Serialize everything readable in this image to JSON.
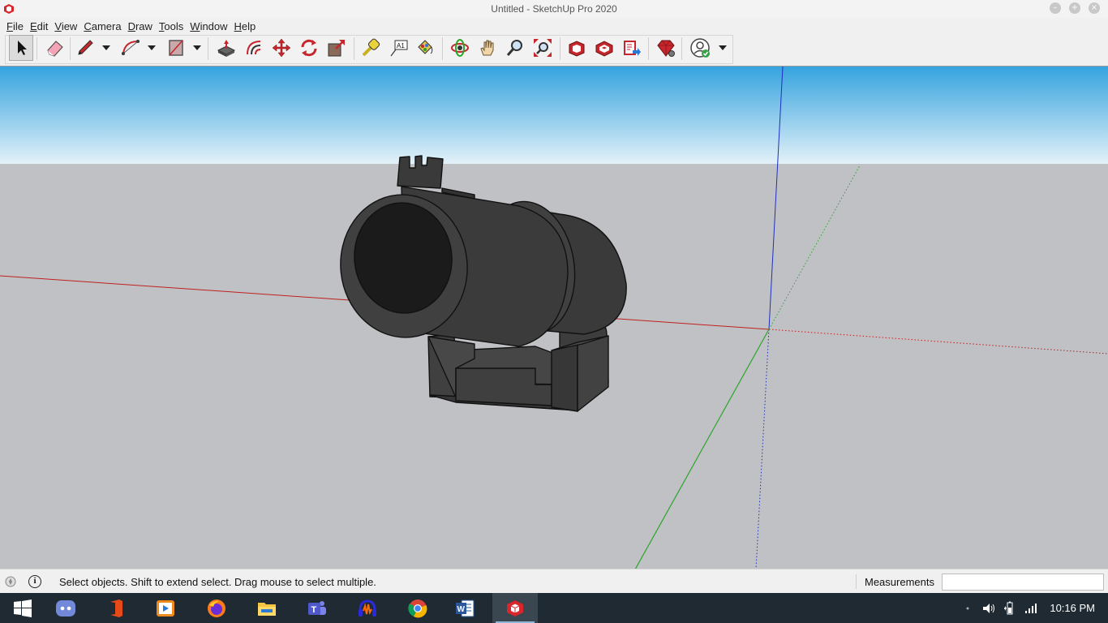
{
  "window": {
    "title": "Untitled - SketchUp Pro 2020",
    "minimize_glyph": "–",
    "maximize_glyph": "+",
    "close_glyph": "×"
  },
  "menu": [
    {
      "label_ul": "F",
      "label_rest": "ile"
    },
    {
      "label_ul": "E",
      "label_rest": "dit"
    },
    {
      "label_ul": "V",
      "label_rest": "iew"
    },
    {
      "label_ul": "C",
      "label_rest": "amera"
    },
    {
      "label_ul": "D",
      "label_rest": "raw"
    },
    {
      "label_ul": "T",
      "label_rest": "ools"
    },
    {
      "label_ul": "W",
      "label_rest": "indow"
    },
    {
      "label_ul": "H",
      "label_rest": "elp"
    }
  ],
  "toolbar": {
    "tools": [
      "select-icon",
      "eraser-icon",
      "pencil-icon",
      "arc-icon",
      "rectangle-icon",
      "push-pull-icon",
      "offset-icon",
      "move-icon",
      "rotate-icon",
      "scale-icon",
      "tape-measure-icon",
      "text-icon",
      "paint-bucket-icon",
      "orbit-icon",
      "pan-icon",
      "zoom-icon",
      "zoom-extents-icon",
      "3d-warehouse-icon",
      "extension-warehouse-icon",
      "send-to-layout-icon",
      "extension-manager-icon",
      "account-icon"
    ]
  },
  "colors": {
    "sky_top": "#35a3df",
    "sky_bottom": "#e3f1f8",
    "ground": "#c0c1c5",
    "red_axis": "#c0201f",
    "green_axis": "#2aa52a",
    "blue_axis": "#1f2fbf",
    "model_fill": "#3d3d3d"
  },
  "status": {
    "message": "Select objects. Shift to extend select. Drag mouse to select multiple.",
    "info_glyph": "i",
    "measurements_label": "Measurements",
    "measurements_value": ""
  },
  "taskbar": {
    "apps": [
      "windows-start-icon",
      "discord-icon",
      "office-icon",
      "media-player-icon",
      "firefox-icon",
      "file-explorer-icon",
      "teams-icon",
      "audacity-icon",
      "chrome-icon",
      "word-icon",
      "sketchup-icon"
    ],
    "clock": "10:16 PM"
  }
}
